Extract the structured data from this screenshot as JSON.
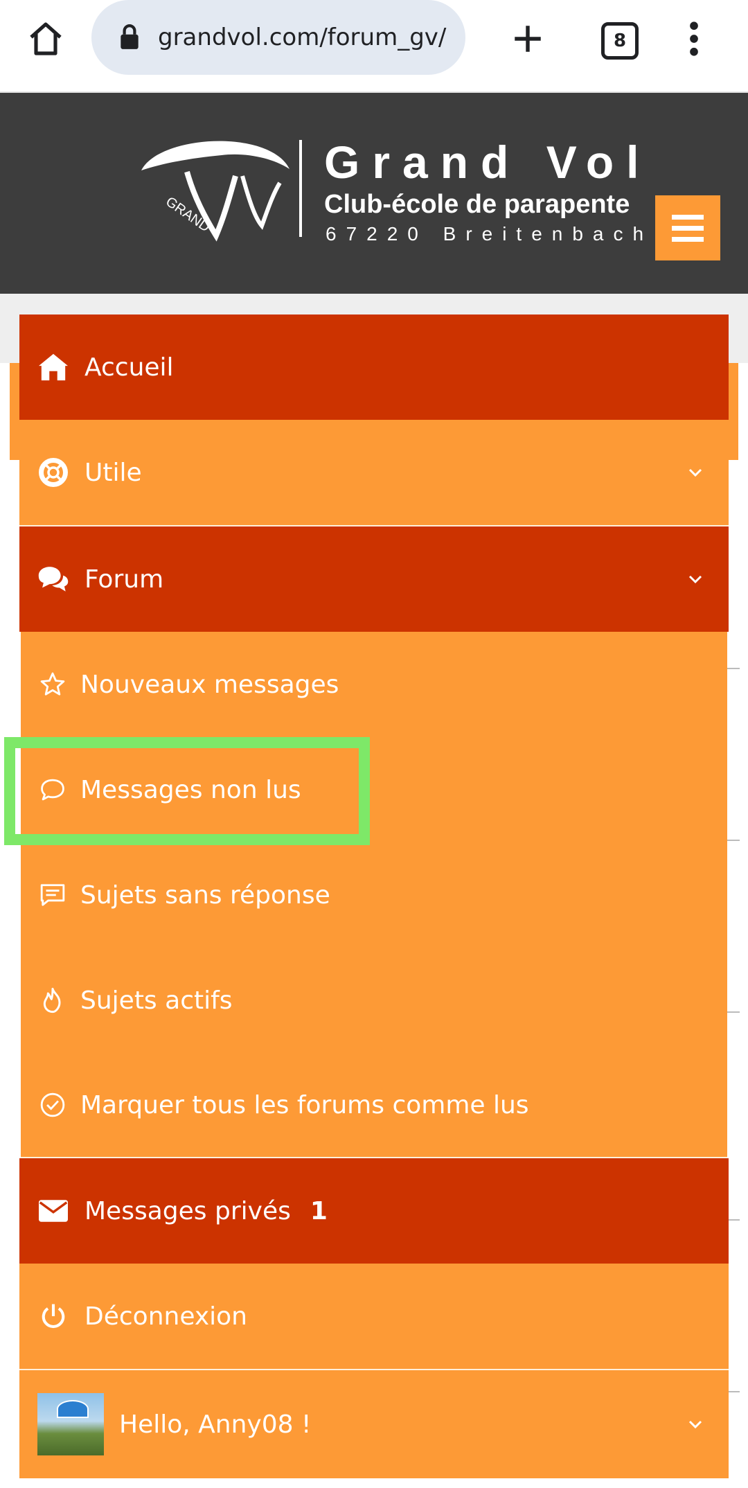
{
  "browser": {
    "url": "grandvol.com/forum_gv/",
    "tab_count": "8"
  },
  "logo": {
    "title": "Grand Vol",
    "subtitle": "Club-école de parapente",
    "address": "67220 Breitenbach",
    "emblem_text": "GRAND"
  },
  "menu": {
    "accueil": "Accueil",
    "utile": "Utile",
    "forum": "Forum",
    "forum_items": [
      {
        "label": "Nouveaux messages",
        "icon": "star-icon"
      },
      {
        "label": "Messages non lus",
        "icon": "speech-bubble-icon"
      },
      {
        "label": "Sujets sans réponse",
        "icon": "message-lines-icon"
      },
      {
        "label": "Sujets actifs",
        "icon": "flame-icon"
      },
      {
        "label": "Marquer tous les forums comme lus",
        "icon": "check-circle-icon"
      }
    ],
    "messages_prives": "Messages privés",
    "messages_prives_count": "1",
    "deconnexion": "Déconnexion",
    "hello": "Hello, Anny08 !"
  },
  "colors": {
    "header_bg": "#3d3d3d",
    "menu_dark": "#cc3300",
    "menu_orange": "#fd9a36",
    "highlight": "#7ee868"
  }
}
